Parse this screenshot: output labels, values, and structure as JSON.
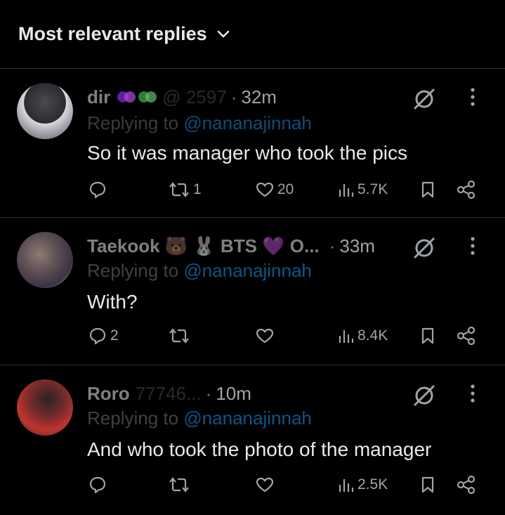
{
  "header": {
    "sort_label": "Most relevant replies",
    "chevron": "chevron-down-icon"
  },
  "replies": [
    {
      "name": "dir",
      "handle": "@ 2597",
      "time": "32m",
      "replying_prefix": "Replying to",
      "replying_handle": "@nananajinnah",
      "text": "So it was manager who took the pics",
      "reply_count": "",
      "retweet_count": "1",
      "like_count": "20",
      "view_count": "5.7K"
    },
    {
      "name": "Taekook 🐻 🐰 BTS 💜 O...",
      "handle": "",
      "time": "33m",
      "replying_prefix": "Replying to",
      "replying_handle": "@nananajinnah",
      "text": "With?",
      "reply_count": "2",
      "retweet_count": "",
      "like_count": "",
      "view_count": "8.4K"
    },
    {
      "name": "Roro",
      "handle": "77746...",
      "time": "10m",
      "replying_prefix": "Replying to",
      "replying_handle": "@nananajinnah",
      "text": "And who took the photo of the manager",
      "reply_count": "",
      "retweet_count": "",
      "like_count": "",
      "view_count": "2.5K"
    }
  ],
  "colors": {
    "background": "#000000",
    "text": "#e7e9ea",
    "muted": "#71767b",
    "accent": "#1d9bf0",
    "divider": "#2f3336"
  }
}
